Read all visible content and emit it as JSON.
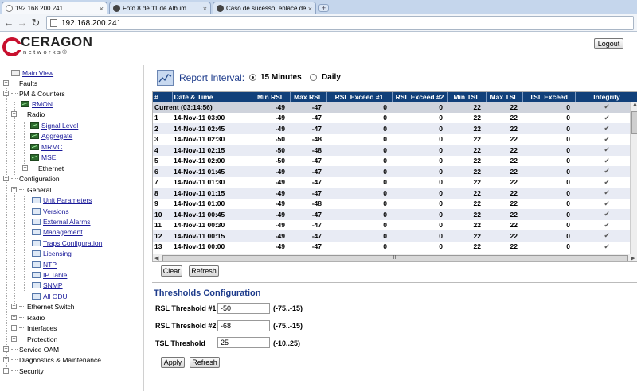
{
  "browser": {
    "tabs": [
      {
        "title": "192.168.200.241",
        "close": "×"
      },
      {
        "title": "Foto 8 de 11 de Album",
        "close": "×"
      },
      {
        "title": "Caso de sucesso, enlace de",
        "close": "×"
      }
    ],
    "new_tab": "+",
    "url": "192.168.200.241",
    "back": "←",
    "forward": "→",
    "reload": "↻"
  },
  "header": {
    "logo_text": "CERAGON",
    "logo_sub": "networks®",
    "logout_label": "Logout"
  },
  "tree": {
    "main_view": "Main View",
    "faults": "Faults",
    "pm_counters": "PM & Counters",
    "rmon": "RMON",
    "radio": "Radio",
    "signal_level": "Signal Level",
    "aggregate": "Aggregate",
    "mrmc": "MRMC",
    "mse": "MSE",
    "ethernet": "Ethernet",
    "configuration": "Configuration",
    "general": "General",
    "unit_parameters": "Unit Parameters",
    "versions": "Versions",
    "external_alarms": "External Alarms",
    "management": "Management",
    "traps_configuration": "Traps Configuration",
    "licensing": "Licensing",
    "ntp": "NTP",
    "ip_table": "IP Table",
    "snmp": "SNMP",
    "all_odu": "All ODU",
    "ethernet_switch": "Ethernet Switch",
    "radio2": "Radio",
    "interfaces": "Interfaces",
    "protection": "Protection",
    "service_oam": "Service OAM",
    "diagnostics": "Diagnostics & Maintenance",
    "security": "Security"
  },
  "report": {
    "label": "Report Interval:",
    "options": [
      "15 Minutes",
      "Daily"
    ],
    "selected": "15 Minutes"
  },
  "grid": {
    "columns": [
      "#",
      "Date & Time",
      "Min RSL",
      "Max RSL",
      "RSL Exceed #1",
      "RSL Exceed #2",
      "Min TSL",
      "Max TSL",
      "TSL Exceed",
      "Integrity"
    ],
    "rows": [
      [
        "Current (03:14:56)",
        "",
        "-49",
        "-47",
        "0",
        "0",
        "22",
        "22",
        "0",
        "✔"
      ],
      [
        "1",
        "14-Nov-11 03:00",
        "-49",
        "-47",
        "0",
        "0",
        "22",
        "22",
        "0",
        "✔"
      ],
      [
        "2",
        "14-Nov-11 02:45",
        "-49",
        "-47",
        "0",
        "0",
        "22",
        "22",
        "0",
        "✔"
      ],
      [
        "3",
        "14-Nov-11 02:30",
        "-50",
        "-48",
        "0",
        "0",
        "22",
        "22",
        "0",
        "✔"
      ],
      [
        "4",
        "14-Nov-11 02:15",
        "-50",
        "-48",
        "0",
        "0",
        "22",
        "22",
        "0",
        "✔"
      ],
      [
        "5",
        "14-Nov-11 02:00",
        "-50",
        "-47",
        "0",
        "0",
        "22",
        "22",
        "0",
        "✔"
      ],
      [
        "6",
        "14-Nov-11 01:45",
        "-49",
        "-47",
        "0",
        "0",
        "22",
        "22",
        "0",
        "✔"
      ],
      [
        "7",
        "14-Nov-11 01:30",
        "-49",
        "-47",
        "0",
        "0",
        "22",
        "22",
        "0",
        "✔"
      ],
      [
        "8",
        "14-Nov-11 01:15",
        "-49",
        "-47",
        "0",
        "0",
        "22",
        "22",
        "0",
        "✔"
      ],
      [
        "9",
        "14-Nov-11 01:00",
        "-49",
        "-48",
        "0",
        "0",
        "22",
        "22",
        "0",
        "✔"
      ],
      [
        "10",
        "14-Nov-11 00:45",
        "-49",
        "-47",
        "0",
        "0",
        "22",
        "22",
        "0",
        "✔"
      ],
      [
        "11",
        "14-Nov-11 00:30",
        "-49",
        "-47",
        "0",
        "0",
        "22",
        "22",
        "0",
        "✔"
      ],
      [
        "12",
        "14-Nov-11 00:15",
        "-49",
        "-47",
        "0",
        "0",
        "22",
        "22",
        "0",
        "✔"
      ],
      [
        "13",
        "14-Nov-11 00:00",
        "-49",
        "-47",
        "0",
        "0",
        "22",
        "22",
        "0",
        "✔"
      ]
    ],
    "scroll_grip": "III"
  },
  "actions": {
    "clear": "Clear",
    "refresh": "Refresh"
  },
  "thresholds": {
    "title": "Thresholds Configuration",
    "rsl1_label": "RSL Threshold #1",
    "rsl1_value": "-50",
    "rsl1_range": "(-75..-15)",
    "rsl2_label": "RSL Threshold #2",
    "rsl2_value": "-68",
    "rsl2_range": "(-75..-15)",
    "tsl_label": "TSL Threshold",
    "tsl_value": "25",
    "tsl_range": "(-10..25)",
    "apply": "Apply",
    "refresh": "Refresh"
  },
  "colors": {
    "header_bg": "#11407a",
    "accent_text": "#1e3c8c",
    "link": "#1a1a9a",
    "logo_red": "#c8102e"
  }
}
